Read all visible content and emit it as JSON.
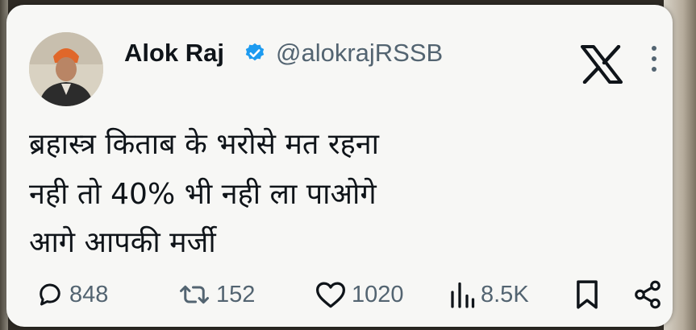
{
  "tweet": {
    "author_name": "Alok Raj",
    "handle": "@alokrajRSSB",
    "verified": true,
    "lines": [
      "ब्रहास्त्र किताब के भरोसे मत रहना",
      "नही तो 40% भी नही ला पाओगे",
      "आगे आपकी मर्जी"
    ]
  },
  "actions": {
    "replies": "848",
    "retweets": "152",
    "likes": "1020",
    "views": "8.5K"
  },
  "icons": {
    "brand": "x-logo-icon",
    "more": "more-vertical-icon",
    "reply": "reply-icon",
    "retweet": "retweet-icon",
    "like": "heart-icon",
    "views": "views-icon",
    "bookmark": "bookmark-icon",
    "share": "share-icon"
  },
  "colors": {
    "verified": "#1d9bf0",
    "text": "#0f1419",
    "secondary": "#536471",
    "card_background": "#f7f7f5"
  }
}
